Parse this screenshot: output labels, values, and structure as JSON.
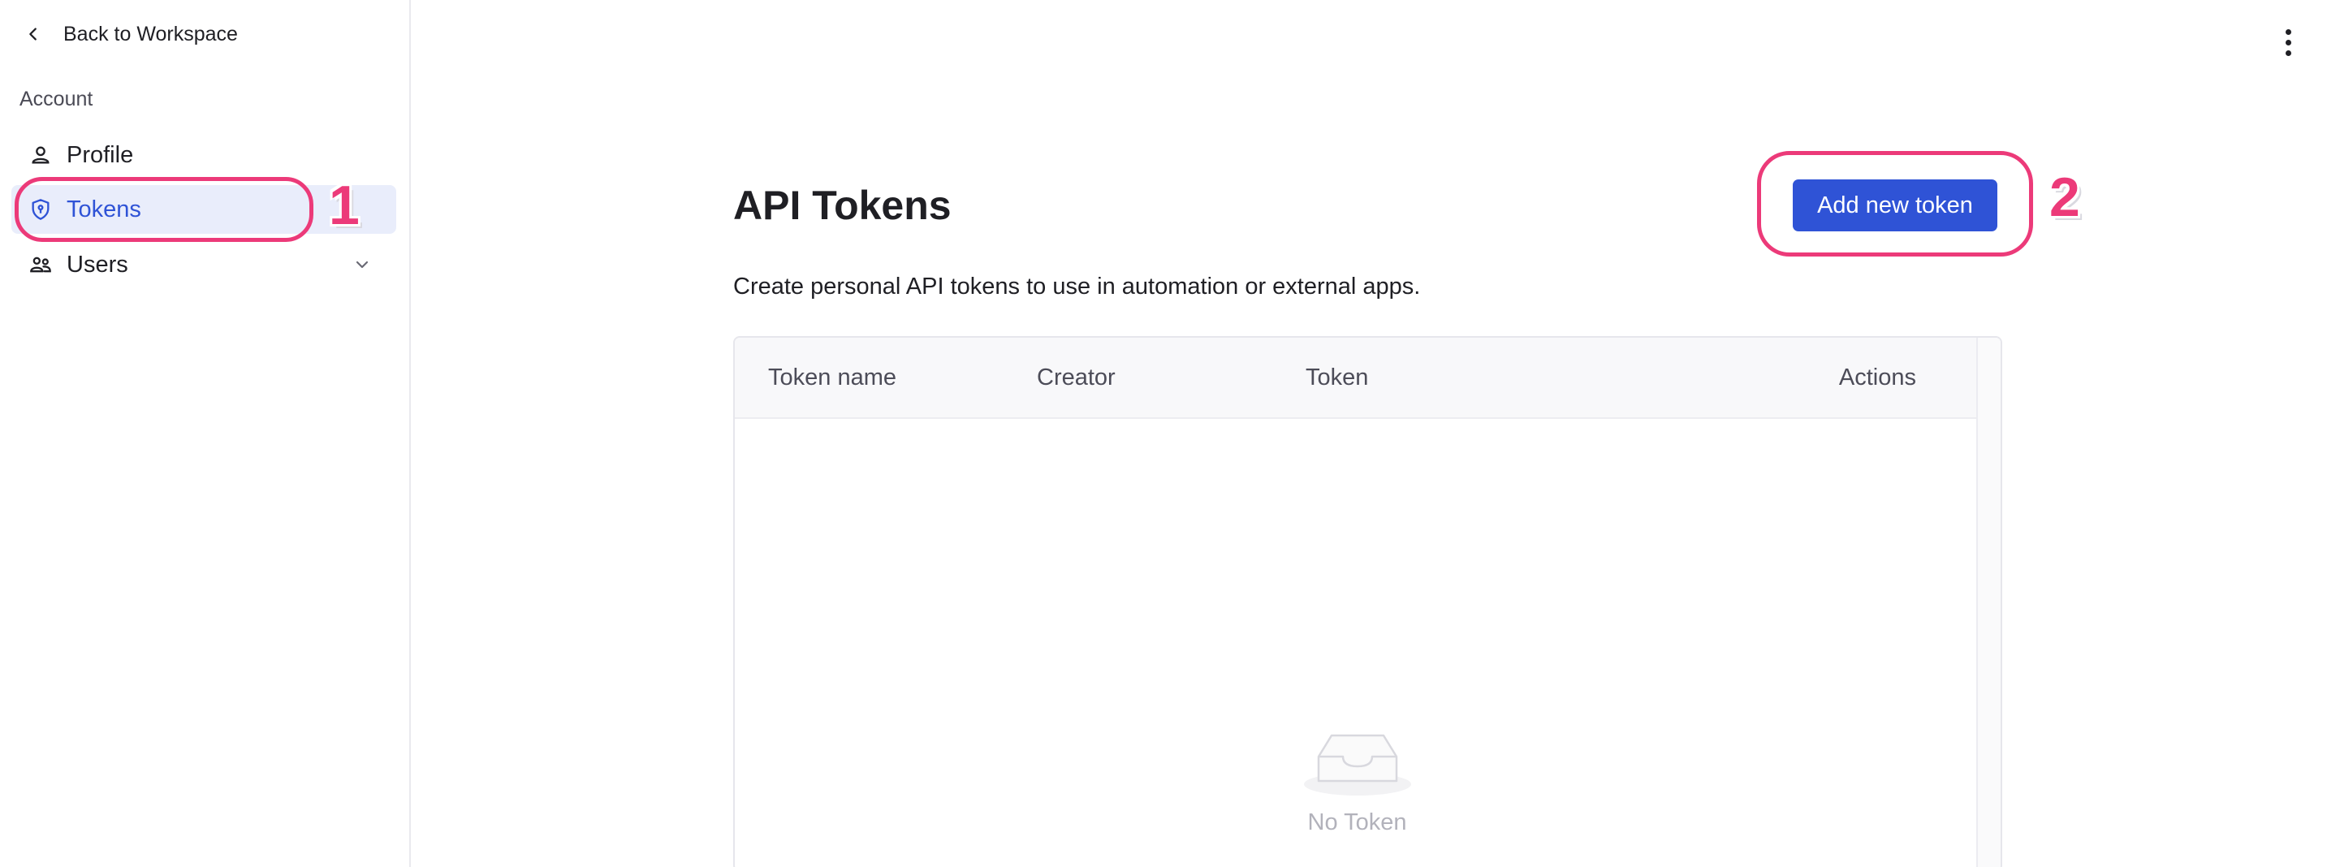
{
  "sidebar": {
    "back_label": "Back to Workspace",
    "section_label": "Account",
    "items": [
      {
        "label": "Profile",
        "icon": "user-icon"
      },
      {
        "label": "Tokens",
        "icon": "shield-icon",
        "active": true
      },
      {
        "label": "Users",
        "icon": "users-icon",
        "expandable": true
      }
    ]
  },
  "main": {
    "title": "API Tokens",
    "subtitle": "Create personal API tokens to use in automation or external apps.",
    "add_button_label": "Add new token",
    "table": {
      "columns": [
        "Token name",
        "Creator",
        "Token",
        "Actions"
      ],
      "rows": [],
      "empty_text": "No Token"
    }
  },
  "annotations": {
    "marker_1": "1",
    "marker_2": "2"
  },
  "colors": {
    "accent": "#2f53d6",
    "active_bg": "#e9edfb",
    "annotation": "#ec3a79"
  }
}
